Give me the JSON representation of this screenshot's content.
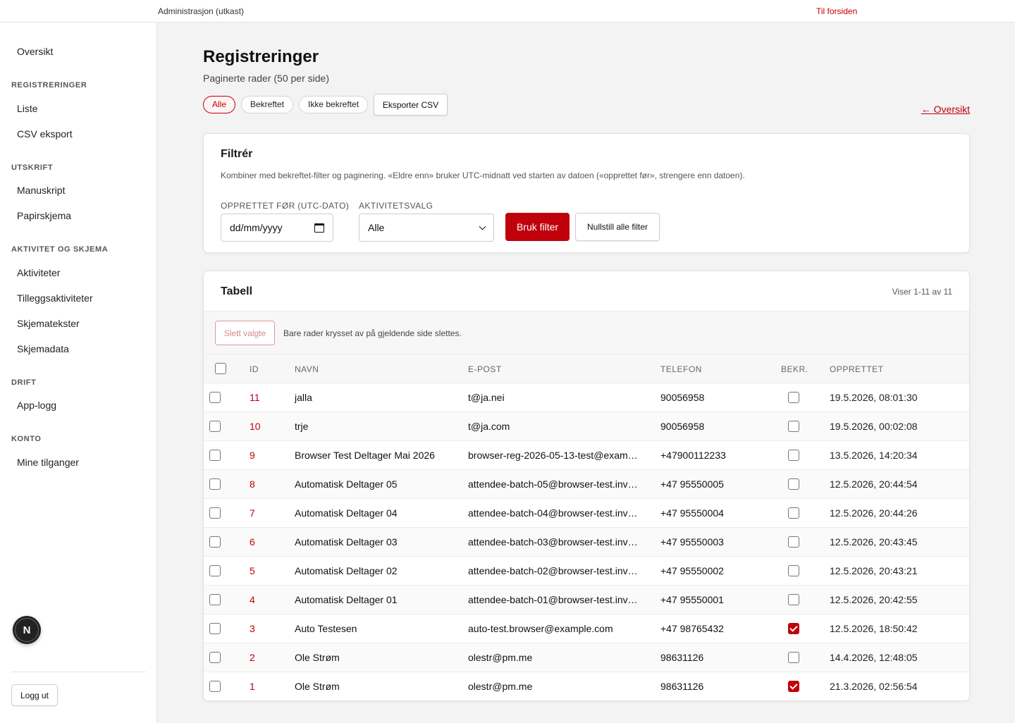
{
  "topbar": {
    "title": "Administrasjon (utkast)",
    "home_link": "Til forsiden"
  },
  "sidebar": {
    "overview": "Oversikt",
    "sections": [
      {
        "title": "REGISTRERINGER",
        "items": [
          "Liste",
          "CSV eksport"
        ]
      },
      {
        "title": "UTSKRIFT",
        "items": [
          "Manuskript",
          "Papirskjema"
        ]
      },
      {
        "title": "AKTIVITET OG SKJEMA",
        "items": [
          "Aktiviteter",
          "Tilleggsaktiviteter",
          "Skjematekster",
          "Skjemadata"
        ]
      },
      {
        "title": "DRIFT",
        "items": [
          "App-logg"
        ]
      },
      {
        "title": "KONTO",
        "items": [
          "Mine tilganger"
        ]
      }
    ],
    "logout": "Logg ut",
    "badge": "N"
  },
  "page": {
    "title": "Registreringer",
    "subtitle": "Paginerte rader (50 per side)",
    "chips": [
      "Alle",
      "Bekreftet",
      "Ikke bekreftet"
    ],
    "active_chip": "Alle",
    "export_label": "Eksporter CSV",
    "back_link": "← Oversikt"
  },
  "filter": {
    "title": "Filtrér",
    "description": "Kombiner med bekreftet-filter og paginering. «Eldre enn» bruker UTC-midnatt ved starten av datoen («opprettet før», strengere enn datoen).",
    "date_label": "OPPRETTET FØR (UTC-DATO)",
    "date_placeholder": "dd/mm/yyyy",
    "activity_label": "AKTIVITETSVALG",
    "activity_value": "Alle",
    "apply_label": "Bruk filter",
    "reset_label": "Nullstill alle filter"
  },
  "table": {
    "title": "Tabell",
    "count": "Viser 1-11 av 11",
    "delete_label": "Slett valgte",
    "delete_note": "Bare rader krysset av på gjeldende side slettes.",
    "columns": [
      "ID",
      "NAVN",
      "E-POST",
      "TELEFON",
      "BEKR.",
      "OPPRETTET"
    ],
    "rows": [
      {
        "id": "11",
        "name": "jalla",
        "email": "t@ja.nei",
        "phone": "90056958",
        "confirmed": false,
        "created": "19.5.2026, 08:01:30"
      },
      {
        "id": "10",
        "name": "trje",
        "email": "t@ja.com",
        "phone": "90056958",
        "confirmed": false,
        "created": "19.5.2026, 00:02:08"
      },
      {
        "id": "9",
        "name": "Browser Test Deltager Mai 2026",
        "email": "browser-reg-2026-05-13-test@exam…",
        "phone": "+47900112233",
        "confirmed": false,
        "created": "13.5.2026, 14:20:34"
      },
      {
        "id": "8",
        "name": "Automatisk Deltager 05",
        "email": "attendee-batch-05@browser-test.inv…",
        "phone": "+47 95550005",
        "confirmed": false,
        "created": "12.5.2026, 20:44:54"
      },
      {
        "id": "7",
        "name": "Automatisk Deltager 04",
        "email": "attendee-batch-04@browser-test.inv…",
        "phone": "+47 95550004",
        "confirmed": false,
        "created": "12.5.2026, 20:44:26"
      },
      {
        "id": "6",
        "name": "Automatisk Deltager 03",
        "email": "attendee-batch-03@browser-test.inv…",
        "phone": "+47 95550003",
        "confirmed": false,
        "created": "12.5.2026, 20:43:45"
      },
      {
        "id": "5",
        "name": "Automatisk Deltager 02",
        "email": "attendee-batch-02@browser-test.inv…",
        "phone": "+47 95550002",
        "confirmed": false,
        "created": "12.5.2026, 20:43:21"
      },
      {
        "id": "4",
        "name": "Automatisk Deltager 01",
        "email": "attendee-batch-01@browser-test.inv…",
        "phone": "+47 95550001",
        "confirmed": false,
        "created": "12.5.2026, 20:42:55"
      },
      {
        "id": "3",
        "name": "Auto Testesen",
        "email": "auto-test.browser@example.com",
        "phone": "+47 98765432",
        "confirmed": true,
        "created": "12.5.2026, 18:50:42"
      },
      {
        "id": "2",
        "name": "Ole Strøm",
        "email": "olestr@pm.me",
        "phone": "98631126",
        "confirmed": false,
        "created": "14.4.2026, 12:48:05"
      },
      {
        "id": "1",
        "name": "Ole Strøm",
        "email": "olestr@pm.me",
        "phone": "98631126",
        "confirmed": true,
        "created": "21.3.2026, 02:56:54"
      }
    ]
  },
  "colors": {
    "accent": "#c0000b",
    "background": "#f3f3f3"
  }
}
